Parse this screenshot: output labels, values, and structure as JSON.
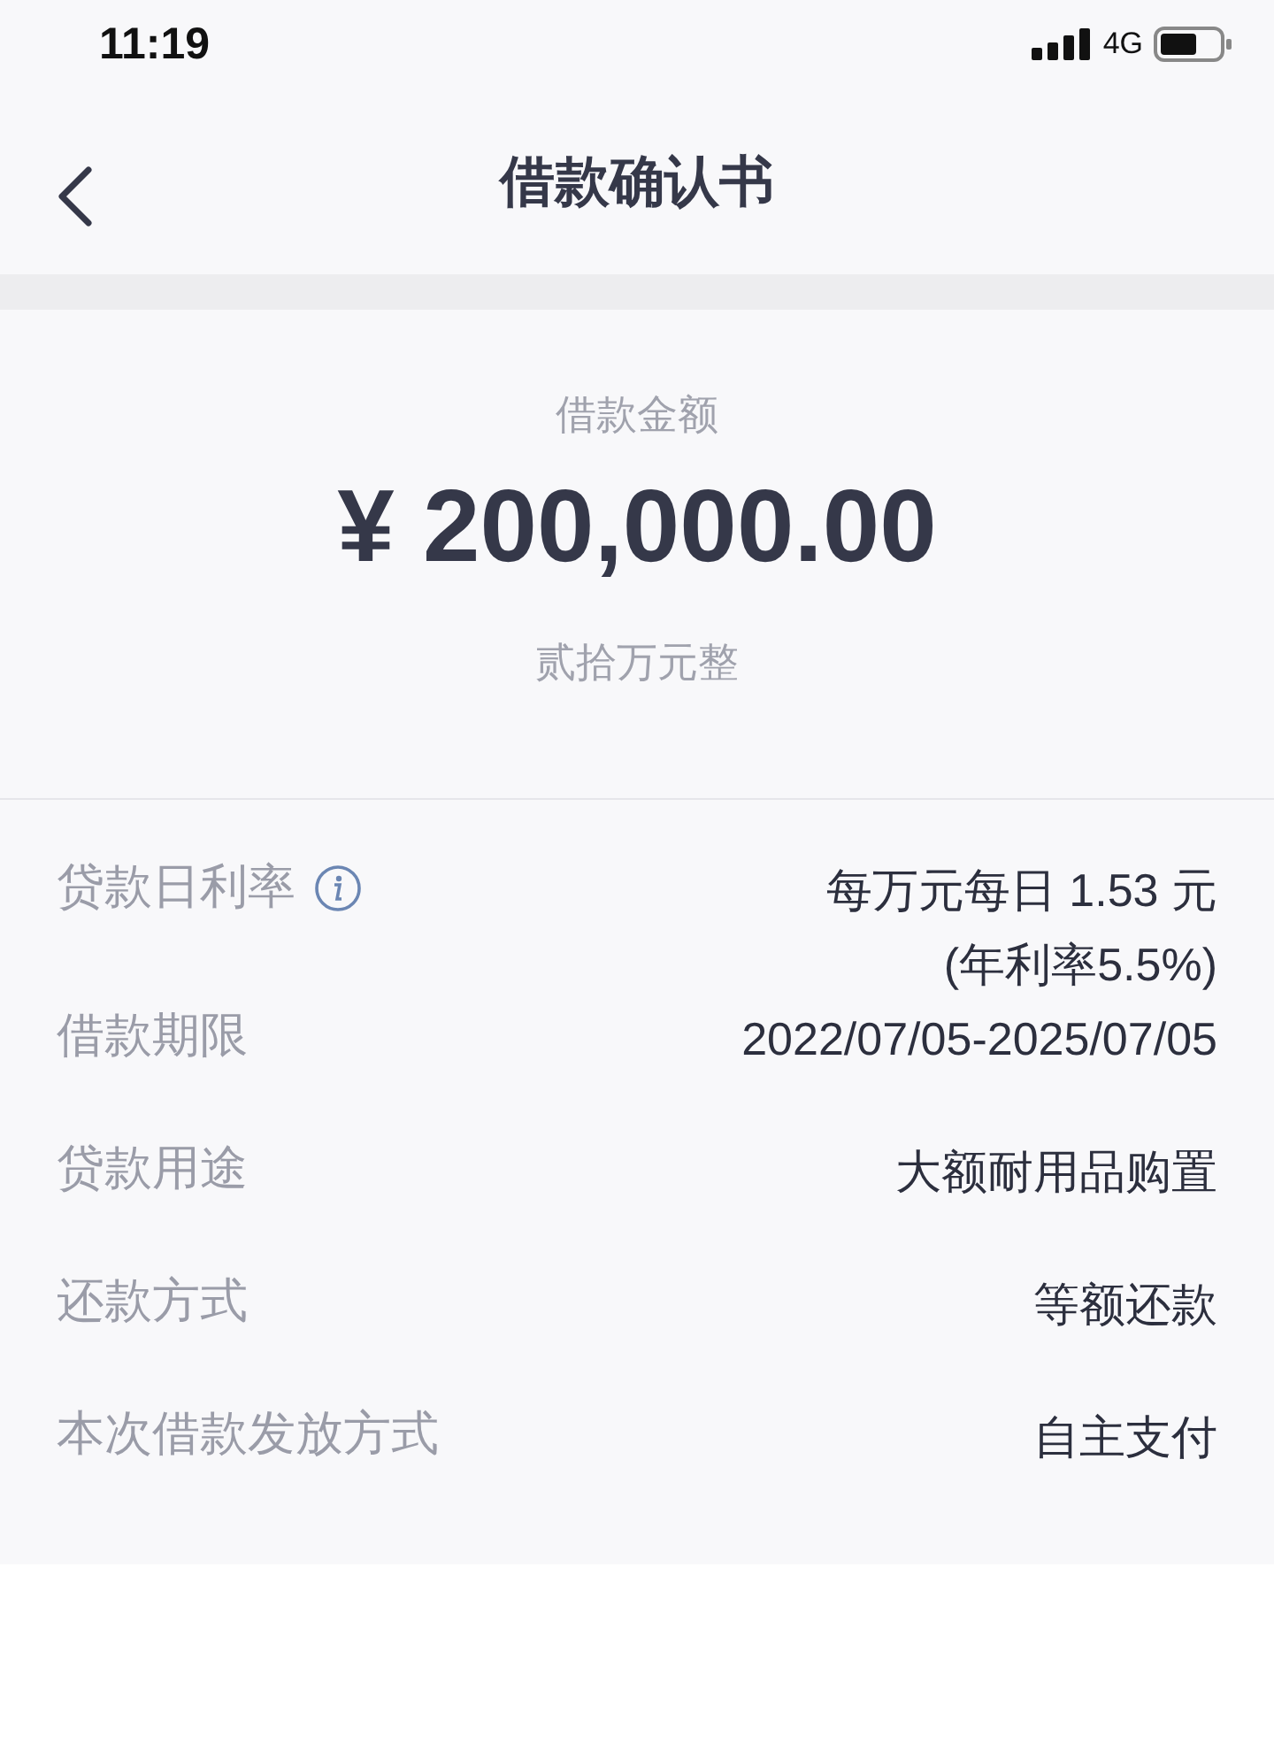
{
  "status_bar": {
    "time": "11:19",
    "network": "4G"
  },
  "nav": {
    "title": "借款确认书"
  },
  "amount": {
    "label": "借款金额",
    "value": "¥ 200,000.00",
    "words": "贰拾万元整"
  },
  "details": [
    {
      "label": "贷款日利率",
      "info": true,
      "value": [
        "每万元每日 1.53 元",
        "(年利率5.5%)"
      ]
    },
    {
      "label": "借款期限",
      "info": false,
      "value": [
        "2022/07/05-2025/07/05"
      ]
    },
    {
      "label": "贷款用途",
      "info": false,
      "value": [
        "大额耐用品购置"
      ]
    },
    {
      "label": "还款方式",
      "info": false,
      "value": [
        "等额还款"
      ]
    },
    {
      "label": "本次借款发放方式",
      "info": false,
      "value": [
        "自主支付"
      ]
    }
  ]
}
